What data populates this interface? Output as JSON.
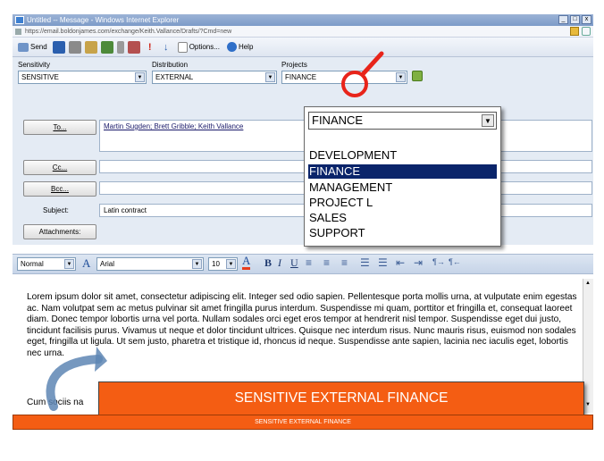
{
  "window": {
    "title": "Untitled -- Message - Windows Internet Explorer",
    "address": "https://email.boldonjames.com/exchange/Keith.Vallance/Drafts/?Cmd=new",
    "controls": [
      "_",
      "□",
      "x"
    ]
  },
  "toolbar": {
    "send_label": "Send",
    "options_label": "Options...",
    "help_label": "Help"
  },
  "classification": {
    "sensitivity_label": "Sensitivity",
    "sensitivity_value": "SENSITIVE",
    "distribution_label": "Distribution",
    "distribution_value": "EXTERNAL",
    "projects_label": "Projects",
    "projects_value": "FINANCE"
  },
  "dropdown": {
    "selected": "FINANCE",
    "options": [
      "DEVELOPMENT",
      "FINANCE",
      "MANAGEMENT",
      "PROJECT L",
      "SALES",
      "SUPPORT"
    ],
    "highlighted_index": 1
  },
  "recipients": {
    "to_button": "To...",
    "to_value": "Martin Sugden; Brett Gribble; Keith Vallance",
    "cc_button": "Cc...",
    "cc_value": "",
    "bcc_button": "Bcc...",
    "bcc_value": "",
    "subject_label": "Subject:",
    "subject_value": "Latin contract",
    "attachments_button": "Attachments:"
  },
  "format": {
    "style_value": "Normal",
    "font_value": "Arial",
    "size_value": "10"
  },
  "body": {
    "text": "Lorem ipsum dolor sit amet, consectetur adipiscing elit. Integer sed odio sapien. Pellentesque porta mollis urna, at vulputate enim egestas ac. Nam volutpat sem ac metus pulvinar sit amet fringilla purus interdum. Suspendisse mi quam, porttitor et fringilla et, consequat laoreet diam. Donec tempor lobortis urna vel porta. Nullam sodales orci eget eros tempor at hendrerit nisl tempor. Suspendisse eget dui justo, tincidunt facilisis purus. Vivamus ut neque et dolor tincidunt ultrices. Quisque nec interdum risus. Nunc mauris risus, euismod non sodales eget, fringilla ut ligula. Ut sem justo, pharetra et tristique id, rhoncus id neque. Suspendisse ante sapien, lacinia nec iaculis eget, lobortis nec urna.",
    "tail_text": "Cum sociis na"
  },
  "labels": {
    "banner_text": "SENSITIVE EXTERNAL FINANCE",
    "footer_text": "SENSITIVE EXTERNAL FINANCE"
  },
  "colors": {
    "accent": "#f45d13",
    "selection": "#0a246a",
    "annotation": "#e8241a"
  }
}
